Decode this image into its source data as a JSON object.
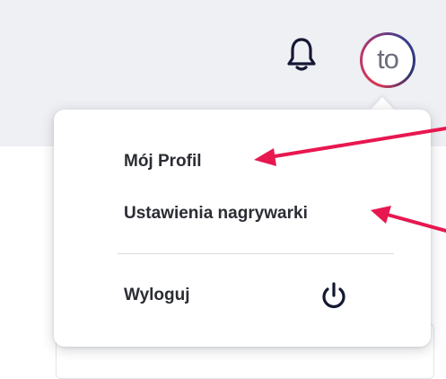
{
  "header": {
    "avatar_initials": "to",
    "bell_icon": "bell-icon"
  },
  "menu": {
    "items": [
      {
        "label": "Mój Profil"
      },
      {
        "label": "Ustawienia nagrywarki"
      },
      {
        "label": "Wyloguj",
        "icon": "power-icon"
      }
    ]
  },
  "colors": {
    "annotation_arrow": "#e8174f",
    "text": "#2b2d33",
    "topbar_bg": "#eff0f4"
  }
}
